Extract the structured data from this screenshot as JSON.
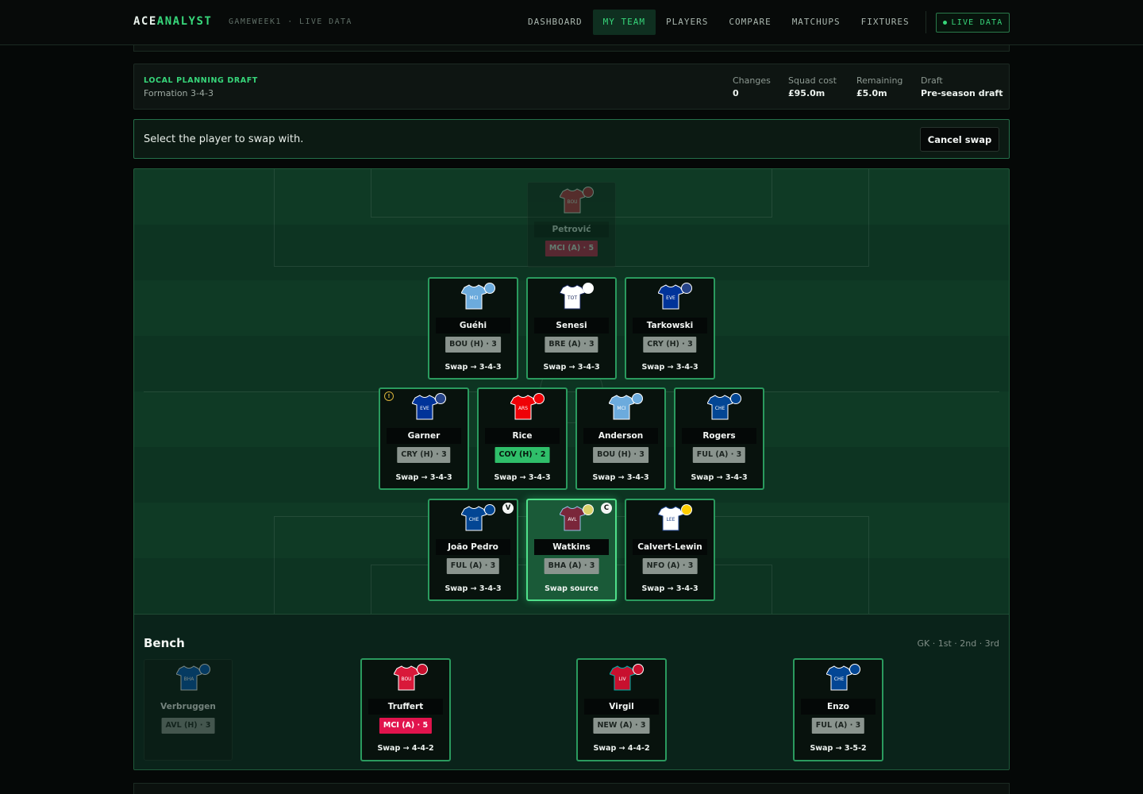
{
  "nav": {
    "brand_main": "ACE",
    "brand_accent": "ANALYST",
    "gameweek": "GAMEWEEK1 · LIVE DATA",
    "items": [
      "DASHBOARD",
      "MY TEAM",
      "PLAYERS",
      "COMPARE",
      "MATCHUPS",
      "FIXTURES"
    ],
    "active": "MY TEAM",
    "live_button": "LIVE DATA"
  },
  "draft": {
    "tag": "LOCAL PLANNING DRAFT",
    "formation": "Formation 3-4-3",
    "stats": [
      {
        "label": "Changes",
        "value": "0"
      },
      {
        "label": "Squad cost",
        "value": "£95.0m"
      },
      {
        "label": "Remaining",
        "value": "£5.0m"
      },
      {
        "label": "Draft",
        "value": "Pre-season draft"
      }
    ]
  },
  "swap": {
    "prompt": "Select the player to swap with.",
    "cancel_label": "Cancel swap"
  },
  "colors": {
    "accent": "#37d67a",
    "fdr2": "#2fbf6a",
    "fdr3": "#8a948e",
    "fdr5": "#e1144d"
  },
  "pitch": {
    "goalkeeper": {
      "name": "Petrović",
      "club": "BOU",
      "fixture": "MCI (A) · 5",
      "fdr": 5,
      "state": "disabled"
    },
    "defenders": [
      {
        "name": "Guéhi",
        "club": "MCI",
        "fixture": "BOU (H) · 3",
        "fdr": 3,
        "action": "Swap → 3-4-3"
      },
      {
        "name": "Senesi",
        "club": "TOT",
        "fixture": "BRE (A) · 3",
        "fdr": 3,
        "action": "Swap → 3-4-3"
      },
      {
        "name": "Tarkowski",
        "club": "EVE",
        "fixture": "CRY (H) · 3",
        "fdr": 3,
        "action": "Swap → 3-4-3"
      }
    ],
    "midfielders": [
      {
        "name": "Garner",
        "club": "EVE",
        "fixture": "CRY (H) · 3",
        "fdr": 3,
        "action": "Swap → 3-4-3"
      },
      {
        "name": "Rice",
        "club": "ARS",
        "fixture": "COV (H) · 2",
        "fdr": 2,
        "action": "Swap → 3-4-3"
      },
      {
        "name": "Anderson",
        "club": "MCI",
        "fixture": "BOU (H) · 3",
        "fdr": 3,
        "action": "Swap → 3-4-3"
      },
      {
        "name": "Rogers",
        "club": "CHE",
        "fixture": "FUL (A) · 3",
        "fdr": 3,
        "action": "Swap → 3-4-3"
      }
    ],
    "forwards": [
      {
        "name": "João Pedro",
        "club": "CHE",
        "fixture": "FUL (A) · 3",
        "fdr": 3,
        "action": "Swap → 3-4-3",
        "armband": "V"
      },
      {
        "name": "Watkins",
        "club": "AVL",
        "fixture": "BHA (A) · 3",
        "fdr": 3,
        "action": "Swap source",
        "armband": "C"
      },
      {
        "name": "Calvert-Lewin",
        "club": "LEE",
        "fixture": "NFO (A) · 3",
        "fdr": 3,
        "action": "Swap → 3-4-3"
      }
    ]
  },
  "bench": {
    "title": "Bench",
    "order": "GK · 1st · 2nd · 3rd",
    "players": [
      {
        "name": "Verbruggen",
        "club": "BHA",
        "fixture": "AVL (H) · 3",
        "fdr": 3,
        "state": "disabled"
      },
      {
        "name": "Truffert",
        "club": "BOU",
        "fixture": "MCI (A) · 5",
        "fdr": 5,
        "action": "Swap → 4-4-2"
      },
      {
        "name": "Virgil",
        "club": "LIV",
        "fixture": "NEW (A) · 3",
        "fdr": 3,
        "action": "Swap → 4-4-2"
      },
      {
        "name": "Enzo",
        "club": "CHE",
        "fixture": "FUL (A) · 3",
        "fdr": 3,
        "action": "Swap → 3-5-2"
      }
    ]
  }
}
